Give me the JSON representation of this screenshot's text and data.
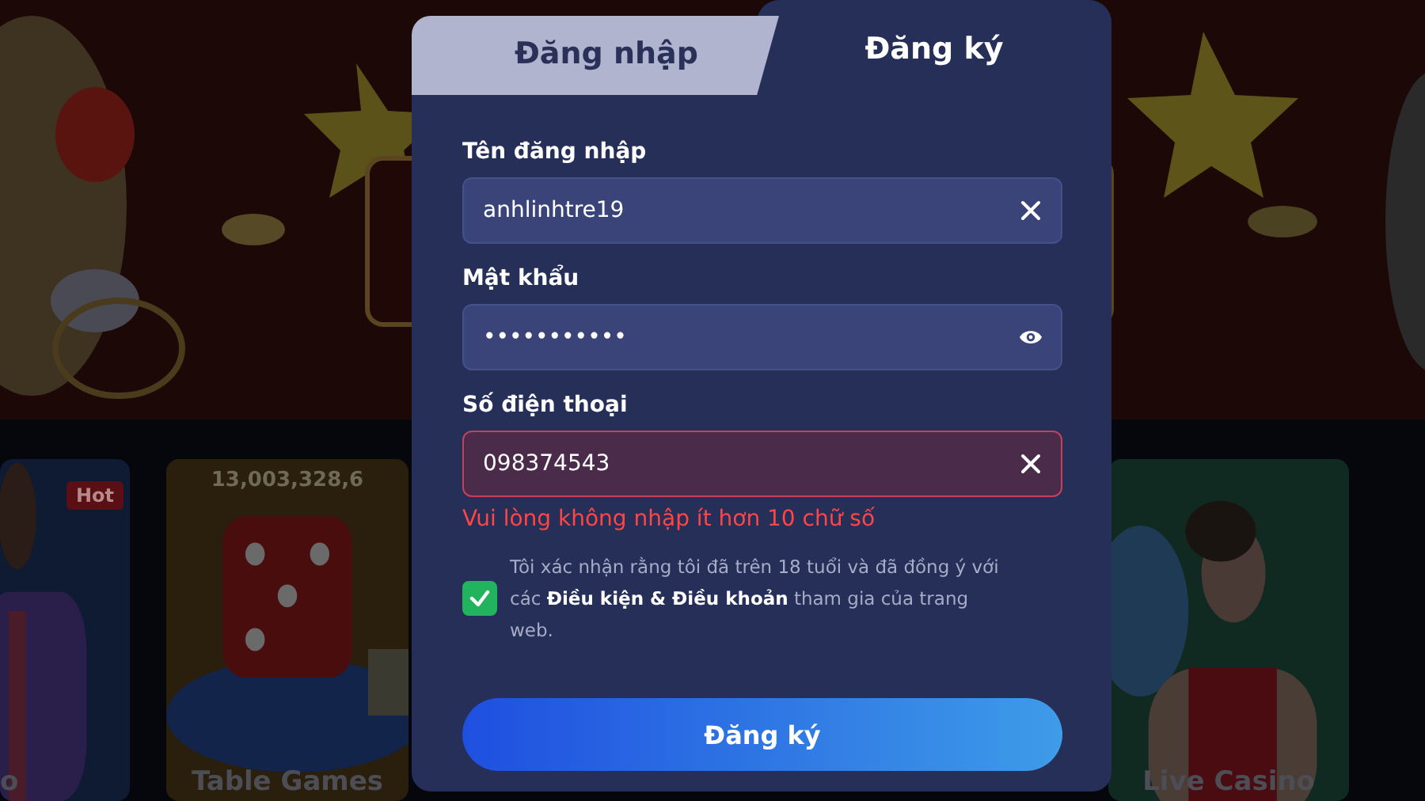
{
  "background": {
    "cards": [
      {
        "title": "o",
        "badge": "Hot"
      },
      {
        "title": "Table Games",
        "jackpot": "13,003,328,6"
      },
      {
        "title": "Live Casino"
      }
    ]
  },
  "tabs": [
    {
      "label": "Đăng nhập",
      "selected": false
    },
    {
      "label": "Đăng ký",
      "selected": true
    }
  ],
  "fields": [
    {
      "label": "Tên đăng nhập",
      "value": "anhlinhtre19",
      "kind": "clearable",
      "invalid": false
    },
    {
      "label": "Mật khẩu",
      "value": "•••••••••••",
      "kind": "password",
      "invalid": false
    },
    {
      "label": "Số điện thoại",
      "value": "098374543",
      "kind": "clearable",
      "invalid": true,
      "error": "Vui lòng không nhập ít hơn 10 chữ số"
    }
  ],
  "agreement": {
    "checked": true,
    "text": "Tôi xác nhận rằng tôi đã trên 18 tuổi và đã đồng ý với các **Điều kiện & Điều khoản** tham gia của trang web."
  },
  "submit": "Đăng ký"
}
